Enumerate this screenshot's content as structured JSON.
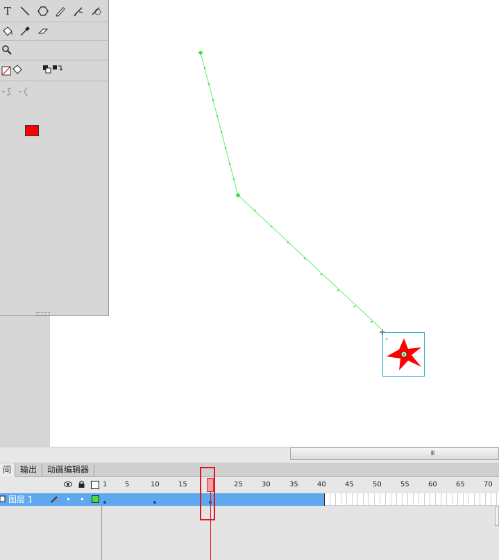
{
  "toolbox": {
    "tools_row1": [
      "text-tool",
      "line-tool",
      "polystar-tool",
      "pencil-tool",
      "brush-tool",
      "deco-tool"
    ],
    "text_tool_glyph": "T",
    "tools_row2": [
      "paint-bucket-tool",
      "eyedropper-tool",
      "eraser-tool"
    ],
    "tools_row3": [
      "zoom-tool"
    ],
    "stroke_color": "none",
    "fill_color": "#ff0000",
    "options_row": [
      "snap-smooth",
      "snap-straighten"
    ]
  },
  "stage": {
    "motion_path_color": "#66ee66",
    "symbol": {
      "shape": "five-point-star",
      "fill": "#ff0000",
      "bounding_box_color": "#2aa6c8"
    }
  },
  "scrollbar": {
    "thumb_glyph": "III"
  },
  "panel": {
    "tabs": [
      {
        "label": "间轴",
        "active": true
      },
      {
        "label": "输出",
        "active": false
      },
      {
        "label": "动画编辑器",
        "active": false
      }
    ],
    "header_icons": [
      "eye-icon",
      "lock-icon",
      "outline-icon"
    ],
    "frame_numbers": [
      "1",
      "5",
      "10",
      "15",
      "20",
      "25",
      "30",
      "35",
      "40",
      "45",
      "50",
      "55",
      "60",
      "65",
      "70"
    ],
    "current_frame": 20,
    "last_frame": 40,
    "layer": {
      "name": "图层 1",
      "color": "#44dd44",
      "selected": true
    },
    "keyframes": [
      1,
      10,
      20
    ]
  }
}
